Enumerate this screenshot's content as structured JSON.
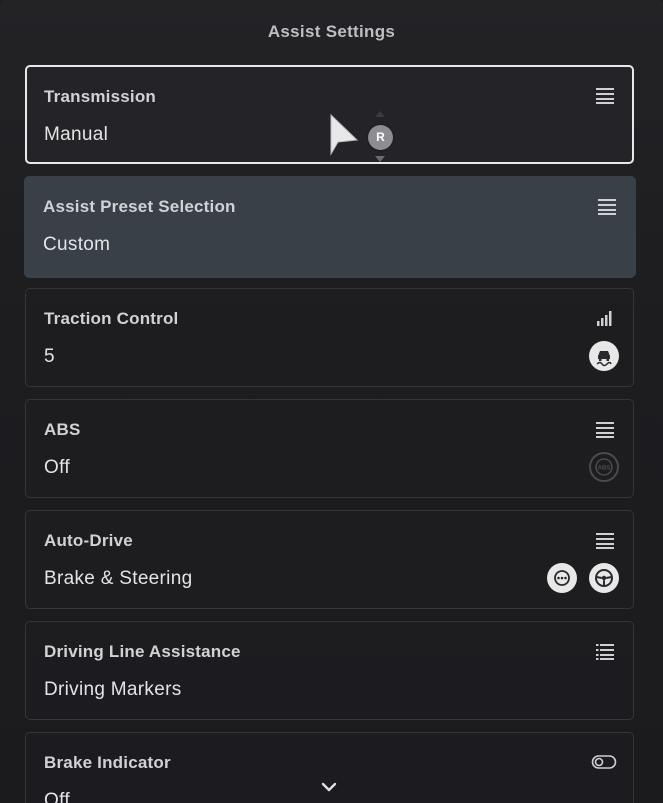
{
  "panel": {
    "title": "Assist Settings"
  },
  "cursor": {
    "badge_label": "R"
  },
  "settings": [
    {
      "label": "Transmission",
      "value": "Manual",
      "type_icon": "list-icon"
    },
    {
      "label": "Assist Preset Selection",
      "value": "Custom",
      "type_icon": "list-icon"
    },
    {
      "label": "Traction Control",
      "value": "5",
      "type_icon": "level-bars-icon",
      "assist_icons": [
        "traction-control-icon"
      ]
    },
    {
      "label": "ABS",
      "value": "Off",
      "type_icon": "list-icon",
      "assist_icons": [
        "abs-icon"
      ]
    },
    {
      "label": "Auto-Drive",
      "value": "Brake & Steering",
      "type_icon": "list-icon",
      "assist_icons": [
        "auto-brake-icon",
        "steering-wheel-icon"
      ]
    },
    {
      "label": "Driving Line Assistance",
      "value": "Driving Markers",
      "type_icon": "bulleted-list-icon"
    },
    {
      "label": "Brake Indicator",
      "value": "Off",
      "type_icon": "toggle-icon"
    }
  ],
  "colors": {
    "background": "#1c1c1f",
    "focus_border": "#e8e8ea",
    "highlight_row": "#3a4048"
  }
}
